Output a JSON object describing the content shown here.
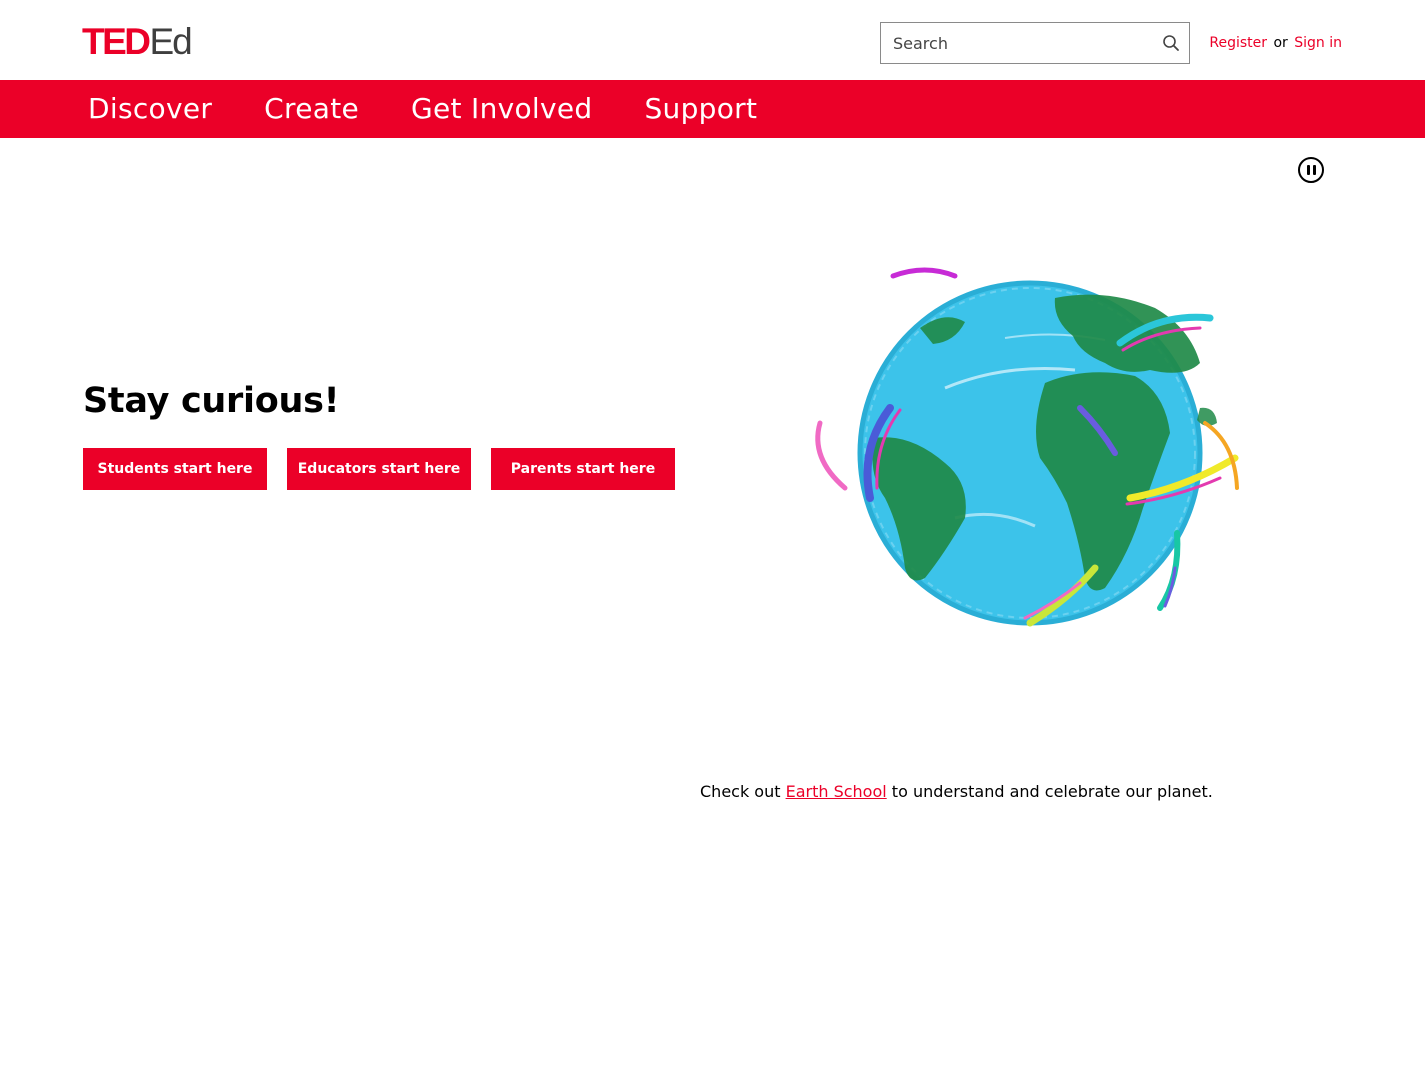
{
  "header": {
    "logo": {
      "ted": "TED",
      "ed": "Ed"
    },
    "search": {
      "placeholder": "Search",
      "value": ""
    },
    "auth": {
      "register": "Register",
      "separator": "or",
      "sign_in": "Sign in"
    }
  },
  "nav": {
    "items": [
      {
        "label": "Discover"
      },
      {
        "label": "Create"
      },
      {
        "label": "Get Involved"
      },
      {
        "label": "Support"
      }
    ]
  },
  "hero": {
    "title": "Stay curious!",
    "buttons": [
      {
        "label": "Students start here"
      },
      {
        "label": "Educators start here"
      },
      {
        "label": "Parents start here"
      }
    ],
    "media_control": {
      "icon": "pause-icon"
    },
    "image": {
      "icon": "globe-illustration"
    }
  },
  "caption": {
    "prefix": "Check out ",
    "link": "Earth School",
    "suffix": " to understand and celebrate our planet."
  },
  "colors": {
    "brand": "#eb0028",
    "logo_ed": "#3f3f3f",
    "ocean": "#3cc3ea",
    "land": "#1f8a48"
  }
}
